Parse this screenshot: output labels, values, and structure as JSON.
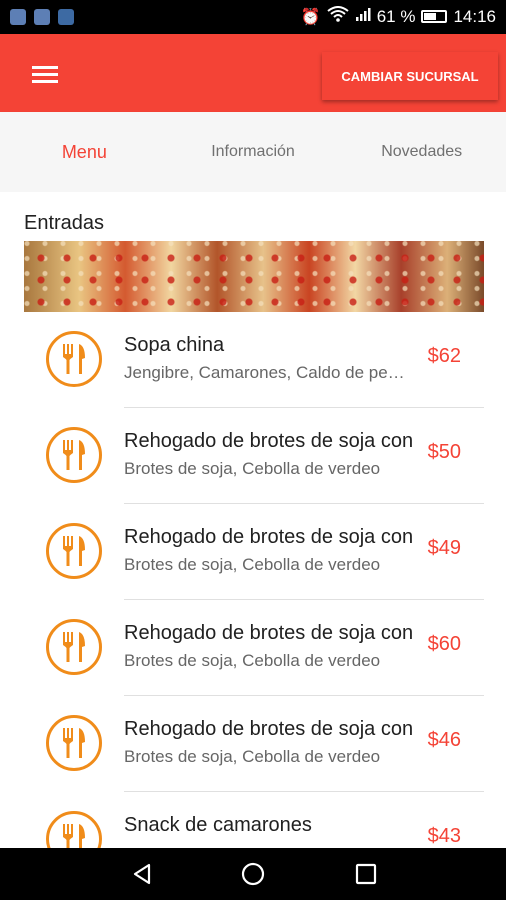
{
  "status_bar": {
    "icons": [
      "notification-app-icon",
      "notification-app-icon",
      "notification-shield-icon"
    ],
    "alarm_icon": "alarm-icon",
    "wifi_icon": "wifi-icon",
    "signal_icon": "signal-icon",
    "battery": "61 %",
    "battery_level": 0.61,
    "time": "14:16"
  },
  "toolbar": {
    "menu_icon": "hamburger-menu-icon",
    "branch_button": "CAMBIAR SUCURSAL"
  },
  "tabs": [
    {
      "label": "Menu",
      "active": true
    },
    {
      "label": "Información",
      "active": false
    },
    {
      "label": "Novedades",
      "active": false
    }
  ],
  "section": {
    "title": "Entradas"
  },
  "items": [
    {
      "name": "Sopa china",
      "desc": "Jengibre, Camarones, Caldo de pescado",
      "price": "$62",
      "icon": "fork-knife-icon"
    },
    {
      "name": "Rehogado de brotes de soja con",
      "desc": "Brotes de soja, Cebolla de verdeo",
      "price": "$50",
      "icon": "fork-knife-icon"
    },
    {
      "name": "Rehogado de brotes de soja con",
      "desc": "Brotes de soja, Cebolla de verdeo",
      "price": "$49",
      "icon": "fork-knife-icon"
    },
    {
      "name": "Rehogado de brotes de soja con",
      "desc": "Brotes de soja, Cebolla de verdeo",
      "price": "$60",
      "icon": "fork-knife-icon"
    },
    {
      "name": "Rehogado de brotes de soja con",
      "desc": "Brotes de soja, Cebolla de verdeo",
      "price": "$46",
      "icon": "fork-knife-icon"
    },
    {
      "name": "Snack de camarones",
      "desc": "",
      "price": "$43",
      "icon": "fork-knife-icon"
    }
  ],
  "nav": {
    "back_icon": "back-triangle-icon",
    "home_icon": "home-circle-icon",
    "recents_icon": "recents-square-icon"
  },
  "colors": {
    "primary": "#f44336",
    "accent": "#f08c1a",
    "text_dark": "#212121",
    "text_muted": "#666666"
  }
}
